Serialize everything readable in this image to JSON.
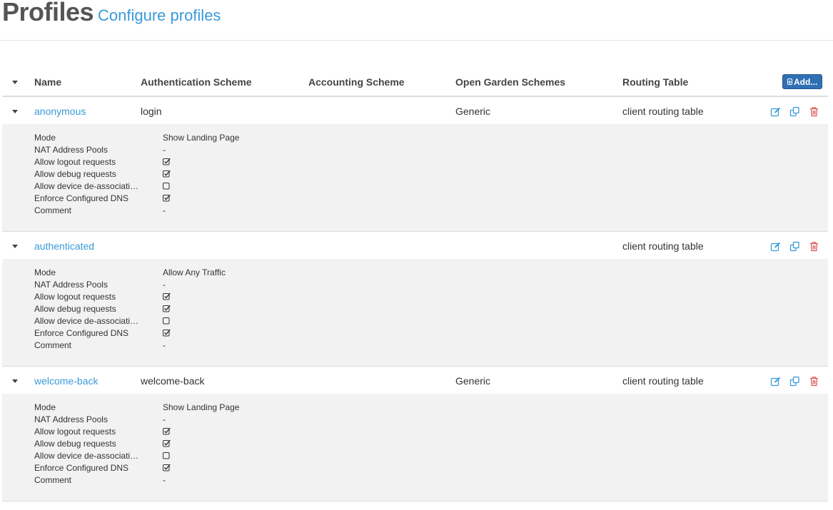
{
  "header": {
    "title": "Profiles",
    "subtitle": "Configure profiles"
  },
  "table": {
    "columns": [
      "Name",
      "Authentication Scheme",
      "Accounting Scheme",
      "Open Garden Schemes",
      "Routing Table"
    ],
    "add_label": "Add...",
    "detail_labels": [
      "Mode",
      "NAT Address Pools",
      "Allow logout requests",
      "Allow debug requests",
      "Allow device de-associati…",
      "Enforce Configured DNS",
      "Comment"
    ]
  },
  "profiles": [
    {
      "name": "anonymous",
      "auth": "login",
      "accounting": "",
      "open_garden": "Generic",
      "routing": "client routing table",
      "mode": "Show Landing Page",
      "nat": "-",
      "logout": true,
      "debug": true,
      "deassoc": false,
      "dns": true,
      "comment": "-"
    },
    {
      "name": "authenticated",
      "auth": "",
      "accounting": "",
      "open_garden": "",
      "routing": "client routing table",
      "mode": "Allow Any Traffic",
      "nat": "-",
      "logout": true,
      "debug": true,
      "deassoc": false,
      "dns": true,
      "comment": "-"
    },
    {
      "name": "welcome-back",
      "auth": "welcome-back",
      "accounting": "",
      "open_garden": "Generic",
      "routing": "client routing table",
      "mode": "Show Landing Page",
      "nat": "-",
      "logout": true,
      "debug": true,
      "deassoc": false,
      "dns": true,
      "comment": "-"
    }
  ],
  "icons": {
    "edit": "edit-icon",
    "copy": "copy-icon",
    "delete": "trash-icon",
    "add": "plus-square-icon",
    "caret": "caret-down-icon",
    "checked": "checkbox-checked-icon",
    "unchecked": "checkbox-unchecked-icon"
  },
  "colors": {
    "link": "#3a9ad9",
    "primary_button": "#2f6fb3",
    "delete": "#d9534f",
    "detail_bg": "#f2f2f2"
  }
}
